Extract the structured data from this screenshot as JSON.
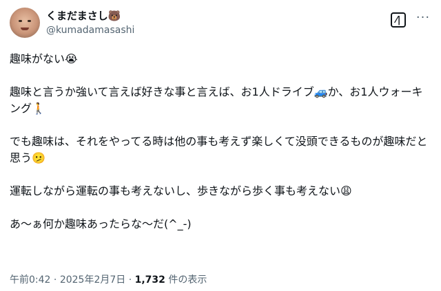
{
  "author": {
    "name": "くまだまさし🐻",
    "handle": "@kumadamasashi"
  },
  "header": {
    "grok_icon": "grok-icon",
    "more_icon": "more-options-icon"
  },
  "post": {
    "paragraphs": [
      "趣味がない😭",
      "趣味と言うか強いて言えば好きな事と言えば、お1人ドライブ🚙か、お1人ウォーキング🚶",
      "でも趣味は、それをやってる時は他の事も考えず楽しくて没頭できるものが趣味だと思う🫤",
      "運転しながら運転の事も考えないし、歩きながら歩く事も考えない😩",
      "あ〜ぁ何か趣味あったらな〜だ(^_-)"
    ]
  },
  "meta": {
    "time": "午前0:42",
    "separator": " · ",
    "date": "2025年2月7日",
    "views_count": "1,732",
    "views_label": " 件の表示"
  }
}
